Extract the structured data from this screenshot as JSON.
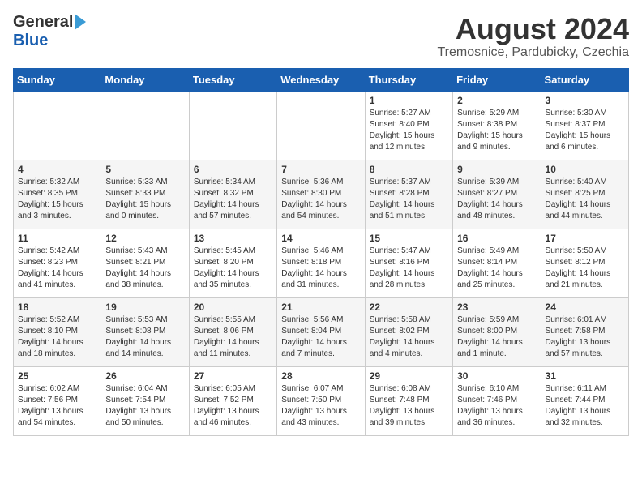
{
  "header": {
    "logo_general": "General",
    "logo_blue": "Blue",
    "title": "August 2024",
    "subtitle": "Tremosnice, Pardubicky, Czechia"
  },
  "days_of_week": [
    "Sunday",
    "Monday",
    "Tuesday",
    "Wednesday",
    "Thursday",
    "Friday",
    "Saturday"
  ],
  "weeks": [
    [
      {
        "day": "",
        "sunrise": "",
        "sunset": "",
        "daylight": ""
      },
      {
        "day": "",
        "sunrise": "",
        "sunset": "",
        "daylight": ""
      },
      {
        "day": "",
        "sunrise": "",
        "sunset": "",
        "daylight": ""
      },
      {
        "day": "",
        "sunrise": "",
        "sunset": "",
        "daylight": ""
      },
      {
        "day": "1",
        "sunrise": "Sunrise: 5:27 AM",
        "sunset": "Sunset: 8:40 PM",
        "daylight": "Daylight: 15 hours and 12 minutes."
      },
      {
        "day": "2",
        "sunrise": "Sunrise: 5:29 AM",
        "sunset": "Sunset: 8:38 PM",
        "daylight": "Daylight: 15 hours and 9 minutes."
      },
      {
        "day": "3",
        "sunrise": "Sunrise: 5:30 AM",
        "sunset": "Sunset: 8:37 PM",
        "daylight": "Daylight: 15 hours and 6 minutes."
      }
    ],
    [
      {
        "day": "4",
        "sunrise": "Sunrise: 5:32 AM",
        "sunset": "Sunset: 8:35 PM",
        "daylight": "Daylight: 15 hours and 3 minutes."
      },
      {
        "day": "5",
        "sunrise": "Sunrise: 5:33 AM",
        "sunset": "Sunset: 8:33 PM",
        "daylight": "Daylight: 15 hours and 0 minutes."
      },
      {
        "day": "6",
        "sunrise": "Sunrise: 5:34 AM",
        "sunset": "Sunset: 8:32 PM",
        "daylight": "Daylight: 14 hours and 57 minutes."
      },
      {
        "day": "7",
        "sunrise": "Sunrise: 5:36 AM",
        "sunset": "Sunset: 8:30 PM",
        "daylight": "Daylight: 14 hours and 54 minutes."
      },
      {
        "day": "8",
        "sunrise": "Sunrise: 5:37 AM",
        "sunset": "Sunset: 8:28 PM",
        "daylight": "Daylight: 14 hours and 51 minutes."
      },
      {
        "day": "9",
        "sunrise": "Sunrise: 5:39 AM",
        "sunset": "Sunset: 8:27 PM",
        "daylight": "Daylight: 14 hours and 48 minutes."
      },
      {
        "day": "10",
        "sunrise": "Sunrise: 5:40 AM",
        "sunset": "Sunset: 8:25 PM",
        "daylight": "Daylight: 14 hours and 44 minutes."
      }
    ],
    [
      {
        "day": "11",
        "sunrise": "Sunrise: 5:42 AM",
        "sunset": "Sunset: 8:23 PM",
        "daylight": "Daylight: 14 hours and 41 minutes."
      },
      {
        "day": "12",
        "sunrise": "Sunrise: 5:43 AM",
        "sunset": "Sunset: 8:21 PM",
        "daylight": "Daylight: 14 hours and 38 minutes."
      },
      {
        "day": "13",
        "sunrise": "Sunrise: 5:45 AM",
        "sunset": "Sunset: 8:20 PM",
        "daylight": "Daylight: 14 hours and 35 minutes."
      },
      {
        "day": "14",
        "sunrise": "Sunrise: 5:46 AM",
        "sunset": "Sunset: 8:18 PM",
        "daylight": "Daylight: 14 hours and 31 minutes."
      },
      {
        "day": "15",
        "sunrise": "Sunrise: 5:47 AM",
        "sunset": "Sunset: 8:16 PM",
        "daylight": "Daylight: 14 hours and 28 minutes."
      },
      {
        "day": "16",
        "sunrise": "Sunrise: 5:49 AM",
        "sunset": "Sunset: 8:14 PM",
        "daylight": "Daylight: 14 hours and 25 minutes."
      },
      {
        "day": "17",
        "sunrise": "Sunrise: 5:50 AM",
        "sunset": "Sunset: 8:12 PM",
        "daylight": "Daylight: 14 hours and 21 minutes."
      }
    ],
    [
      {
        "day": "18",
        "sunrise": "Sunrise: 5:52 AM",
        "sunset": "Sunset: 8:10 PM",
        "daylight": "Daylight: 14 hours and 18 minutes."
      },
      {
        "day": "19",
        "sunrise": "Sunrise: 5:53 AM",
        "sunset": "Sunset: 8:08 PM",
        "daylight": "Daylight: 14 hours and 14 minutes."
      },
      {
        "day": "20",
        "sunrise": "Sunrise: 5:55 AM",
        "sunset": "Sunset: 8:06 PM",
        "daylight": "Daylight: 14 hours and 11 minutes."
      },
      {
        "day": "21",
        "sunrise": "Sunrise: 5:56 AM",
        "sunset": "Sunset: 8:04 PM",
        "daylight": "Daylight: 14 hours and 7 minutes."
      },
      {
        "day": "22",
        "sunrise": "Sunrise: 5:58 AM",
        "sunset": "Sunset: 8:02 PM",
        "daylight": "Daylight: 14 hours and 4 minutes."
      },
      {
        "day": "23",
        "sunrise": "Sunrise: 5:59 AM",
        "sunset": "Sunset: 8:00 PM",
        "daylight": "Daylight: 14 hours and 1 minute."
      },
      {
        "day": "24",
        "sunrise": "Sunrise: 6:01 AM",
        "sunset": "Sunset: 7:58 PM",
        "daylight": "Daylight: 13 hours and 57 minutes."
      }
    ],
    [
      {
        "day": "25",
        "sunrise": "Sunrise: 6:02 AM",
        "sunset": "Sunset: 7:56 PM",
        "daylight": "Daylight: 13 hours and 54 minutes."
      },
      {
        "day": "26",
        "sunrise": "Sunrise: 6:04 AM",
        "sunset": "Sunset: 7:54 PM",
        "daylight": "Daylight: 13 hours and 50 minutes."
      },
      {
        "day": "27",
        "sunrise": "Sunrise: 6:05 AM",
        "sunset": "Sunset: 7:52 PM",
        "daylight": "Daylight: 13 hours and 46 minutes."
      },
      {
        "day": "28",
        "sunrise": "Sunrise: 6:07 AM",
        "sunset": "Sunset: 7:50 PM",
        "daylight": "Daylight: 13 hours and 43 minutes."
      },
      {
        "day": "29",
        "sunrise": "Sunrise: 6:08 AM",
        "sunset": "Sunset: 7:48 PM",
        "daylight": "Daylight: 13 hours and 39 minutes."
      },
      {
        "day": "30",
        "sunrise": "Sunrise: 6:10 AM",
        "sunset": "Sunset: 7:46 PM",
        "daylight": "Daylight: 13 hours and 36 minutes."
      },
      {
        "day": "31",
        "sunrise": "Sunrise: 6:11 AM",
        "sunset": "Sunset: 7:44 PM",
        "daylight": "Daylight: 13 hours and 32 minutes."
      }
    ]
  ]
}
